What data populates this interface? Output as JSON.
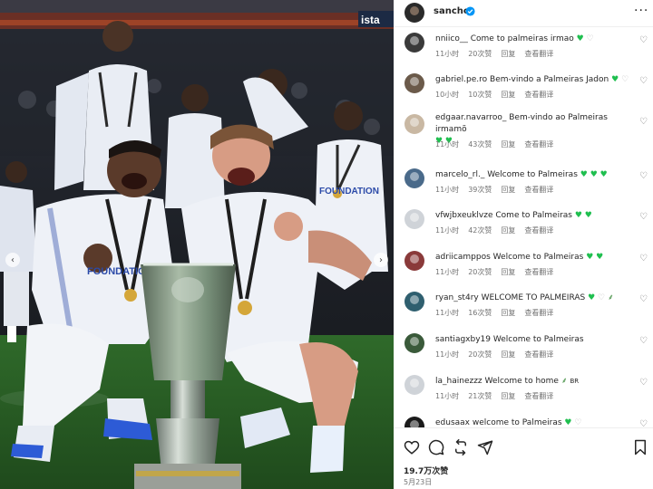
{
  "post": {
    "author": "sancho",
    "verified": true,
    "photo_description_icon": "trophy-celebration-photo",
    "sign_text": "ista",
    "jersey_text_left": "FOUNDATION",
    "jersey_text_right": "FOUNDATION"
  },
  "comments": [
    {
      "user": "nniico__",
      "text": "Come to palmeiras irmao",
      "time": "11小时",
      "likes": "20次赞",
      "reply": "回复",
      "translate": "查看翻译",
      "avatar_color": "#3a3a3a"
    },
    {
      "user": "gabriel.pe.ro",
      "text": "Bem-vindo a Palmeiras Jadon",
      "time": "10小时",
      "likes": "10次赞",
      "reply": "回复",
      "translate": "查看翻译",
      "avatar_color": "#6b5a4a"
    },
    {
      "user": "edgaar.navarroo_",
      "text": "Bem-vindo ao Palmeiras irmamõ",
      "time": "11小时",
      "likes": "43次赞",
      "reply": "回复",
      "translate": "查看翻译",
      "avatar_color": "#c9b8a3"
    },
    {
      "user": "marcelo_rl._",
      "text": "Welcome to Palmeiras",
      "time": "11小时",
      "likes": "39次赞",
      "reply": "回复",
      "translate": "查看翻译",
      "avatar_color": "#4a6a8a"
    },
    {
      "user": "vfwjbxeuklvze",
      "text": "Come to Palmeiras",
      "time": "11小时",
      "likes": "42次赞",
      "reply": "回复",
      "translate": "查看翻译",
      "avatar_color": "#cfd3d8"
    },
    {
      "user": "adriicamppos",
      "text": "Welcome to Palmeiras",
      "time": "11小时",
      "likes": "20次赞",
      "reply": "回复",
      "translate": "查看翻译",
      "avatar_color": "#8a3a3a"
    },
    {
      "user": "ryan_st4ry",
      "text": "WELCOME TO PALMEIRAS",
      "time": "11小时",
      "likes": "16次赞",
      "reply": "回复",
      "translate": "查看翻译",
      "avatar_color": "#2f5f6f"
    },
    {
      "user": "santiagxby19",
      "text": "Welcome to Palmeiras",
      "time": "11小时",
      "likes": "20次赞",
      "reply": "回复",
      "translate": "查看翻译",
      "avatar_color": "#3a5a3a"
    },
    {
      "user": "la_hainezzz",
      "text": "Welcome to home",
      "time": "11小时",
      "likes": "21次赞",
      "reply": "回复",
      "translate": "查看翻译",
      "avatar_color": "#cfd3d8",
      "suffix": "BR"
    },
    {
      "user": "edusaax",
      "text": "welcome to Palmeiras",
      "time": "",
      "likes": "",
      "reply": "",
      "translate": "",
      "avatar_color": "#1a1a1a"
    }
  ],
  "footer": {
    "likes": "19.7万次赞",
    "date": "5月23日"
  },
  "icons": {
    "like": "heart-outline-icon",
    "comment": "comment-bubble-icon",
    "share": "repost-icon",
    "send": "send-paper-plane-icon",
    "save": "bookmark-icon",
    "more": "more-dots-icon",
    "verified": "verified-badge-icon",
    "green_heart": "green-heart-emoji",
    "palm": "palm-tree-emoji"
  },
  "colors": {
    "accent_green": "#1fbf4f",
    "verified_blue": "#0095f6",
    "meta_gray": "#737373",
    "text": "#262626"
  }
}
